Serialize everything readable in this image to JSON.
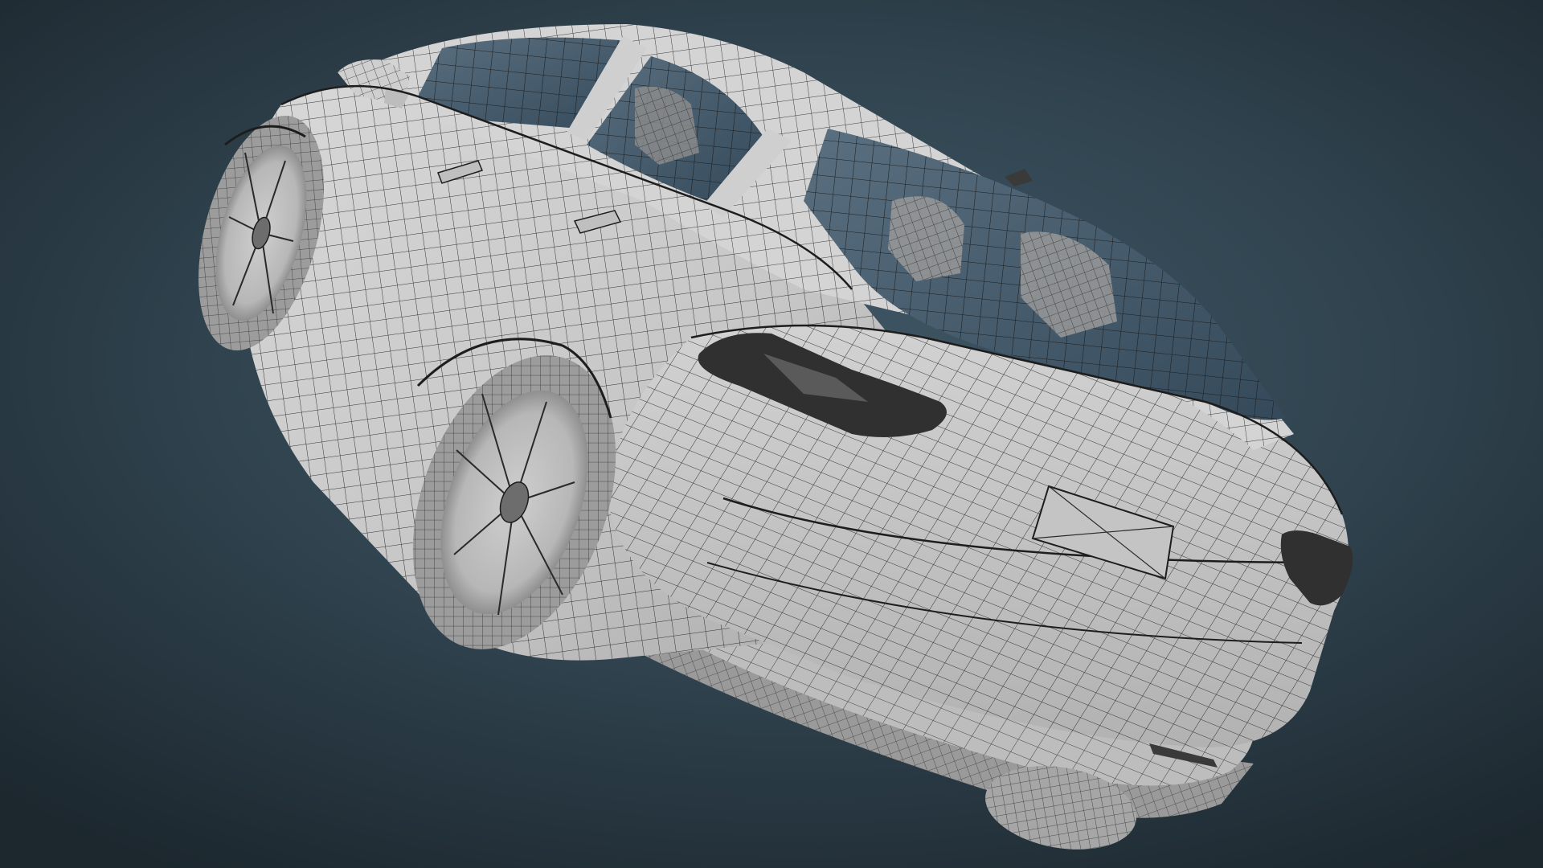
{
  "scene": {
    "subject": "car-wireframe-render",
    "background_color_center": "#3f5664",
    "background_color_edge": "#1c272e",
    "body_color": "#c9c9c9",
    "wire_color": "#2a2a2a",
    "glass_color": "#43596a"
  }
}
